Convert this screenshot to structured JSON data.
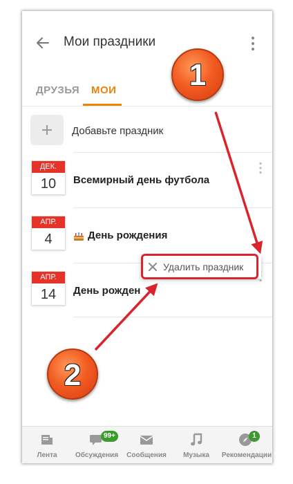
{
  "header": {
    "title": "Мои праздники"
  },
  "tabs": [
    {
      "label": "ДРУЗЬЯ",
      "active": false
    },
    {
      "label": "МОИ",
      "active": true
    }
  ],
  "add_holiday": {
    "label": "Добавьте праздник"
  },
  "events": [
    {
      "month": "ДЕК.",
      "day": "10",
      "name": "Всемирный день футбола",
      "icon": null
    },
    {
      "month": "АПР.",
      "day": "4",
      "name": "День рождения",
      "icon": "cake-icon"
    },
    {
      "month": "АПР.",
      "day": "14",
      "name": "День рожден",
      "icon": null
    }
  ],
  "popup_menu": {
    "items": [
      {
        "label": "Удалить праздник",
        "icon": "close-icon"
      }
    ]
  },
  "bottom_nav": [
    {
      "label": "Лента",
      "icon": "feed-icon"
    },
    {
      "label": "Обсуждения",
      "icon": "discussions-icon",
      "badge": "99+"
    },
    {
      "label": "Сообщения",
      "icon": "messages-icon"
    },
    {
      "label": "Музыка",
      "icon": "music-icon"
    },
    {
      "label": "Рекомендации",
      "icon": "recommendations-icon",
      "badge": "1"
    }
  ],
  "callouts": [
    {
      "number": "1"
    },
    {
      "number": "2"
    }
  ],
  "colors": {
    "accent": "#ee8208",
    "calendar_red": "#e5332a",
    "highlight_red": "#d9232d",
    "badge_green": "#3c9b2e",
    "callout_orange": "#f25d22"
  }
}
